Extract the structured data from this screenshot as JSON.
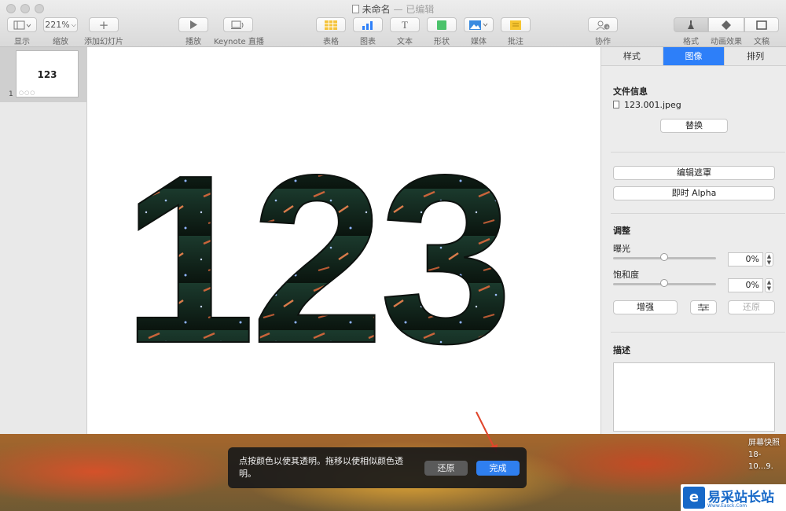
{
  "window": {
    "title": "未命名",
    "subtitle": "— 已编辑"
  },
  "toolbar": {
    "view_label": "显示",
    "zoom_value": "221%",
    "zoom_label": "缩放",
    "add_slide_label": "添加幻灯片",
    "play_label": "播放",
    "keynote_live_label": "Keynote 直播",
    "table_label": "表格",
    "chart_label": "图表",
    "text_label": "文本",
    "shape_label": "形状",
    "media_label": "媒体",
    "comment_label": "批注",
    "collaborate_label": "协作",
    "format_label": "格式",
    "animate_label": "动画效果",
    "document_label": "文稿"
  },
  "navigator": {
    "slide_number": "1",
    "thumbnail_text": "123"
  },
  "slide": {
    "text": "123"
  },
  "inspector": {
    "tabs": [
      "样式",
      "图像",
      "排列"
    ],
    "active_tab": 1,
    "file_info_title": "文件信息",
    "file_name": "123.001.jpeg",
    "replace_button": "替换",
    "edit_mask_button": "编辑遮罩",
    "instant_alpha_button": "即时 Alpha",
    "adjust_title": "调整",
    "exposure_label": "曝光",
    "exposure_value": "0%",
    "saturation_label": "饱和度",
    "saturation_value": "0%",
    "enhance_button": "增强",
    "revert_button": "还原",
    "description_title": "描述"
  },
  "hud": {
    "message": "点按颜色以使其透明。拖移以使相似颜色透明。",
    "revert_button": "还原",
    "done_button": "完成"
  },
  "desktop": {
    "screenshot_label_line1": "屏幕快照",
    "screenshot_label_line2": "18-10...9."
  },
  "watermark": {
    "logo_char": "e",
    "text": "易采站长站",
    "subtext": "Www.Easck.Com"
  },
  "colors": {
    "accent": "#2d7ff9",
    "done_button": "#2f7fef"
  }
}
